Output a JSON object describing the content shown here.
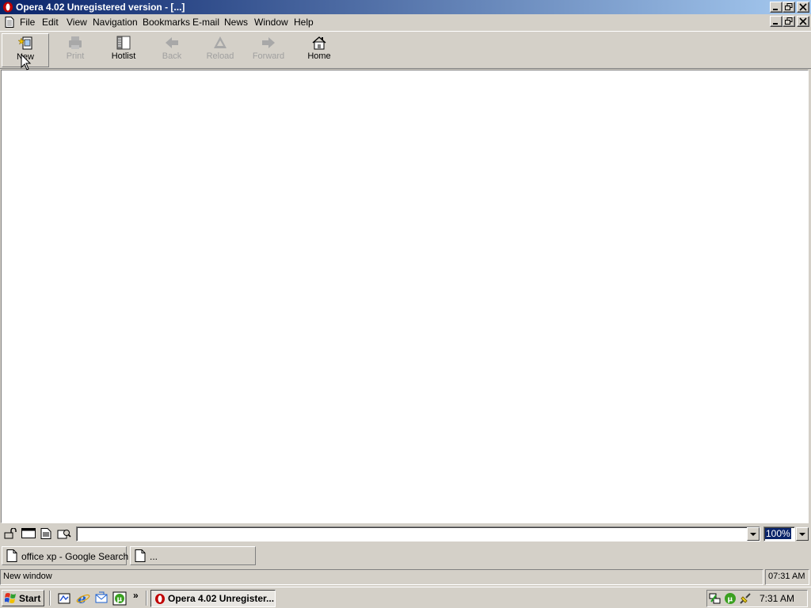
{
  "window": {
    "title": "Opera 4.02 Unregistered version - [...]"
  },
  "menu": {
    "items": [
      "File",
      "Edit",
      "View",
      "Navigation",
      "Bookmarks",
      "E-mail",
      "News",
      "Window",
      "Help"
    ]
  },
  "toolbar": {
    "buttons": [
      {
        "label": "New",
        "icon": "new-window-icon",
        "enabled": true,
        "pressed": true
      },
      {
        "label": "Print",
        "icon": "print-icon",
        "enabled": false
      },
      {
        "label": "Hotlist",
        "icon": "hotlist-icon",
        "enabled": true
      },
      {
        "label": "Back",
        "icon": "back-arrow-icon",
        "enabled": false
      },
      {
        "label": "Reload",
        "icon": "reload-icon",
        "enabled": false
      },
      {
        "label": "Forward",
        "icon": "forward-arrow-icon",
        "enabled": false
      },
      {
        "label": "Home",
        "icon": "home-icon",
        "enabled": true
      }
    ]
  },
  "address": {
    "url_value": "",
    "zoom": "100%"
  },
  "page_tabs": [
    {
      "label": "office xp - Google Search",
      "icon": "document-icon"
    },
    {
      "label": "...",
      "icon": "document-icon"
    }
  ],
  "status": {
    "message": "New window",
    "time": "07:31 AM"
  },
  "taskbar": {
    "start_label": "Start",
    "task_label": "Opera 4.02 Unregister...",
    "clock": "7:31 AM",
    "chevron": "»"
  },
  "colors": {
    "titlebar_start": "#0a246a",
    "titlebar_end": "#a6caf0",
    "chrome": "#d4d0c8",
    "opera_red": "#c00000"
  }
}
